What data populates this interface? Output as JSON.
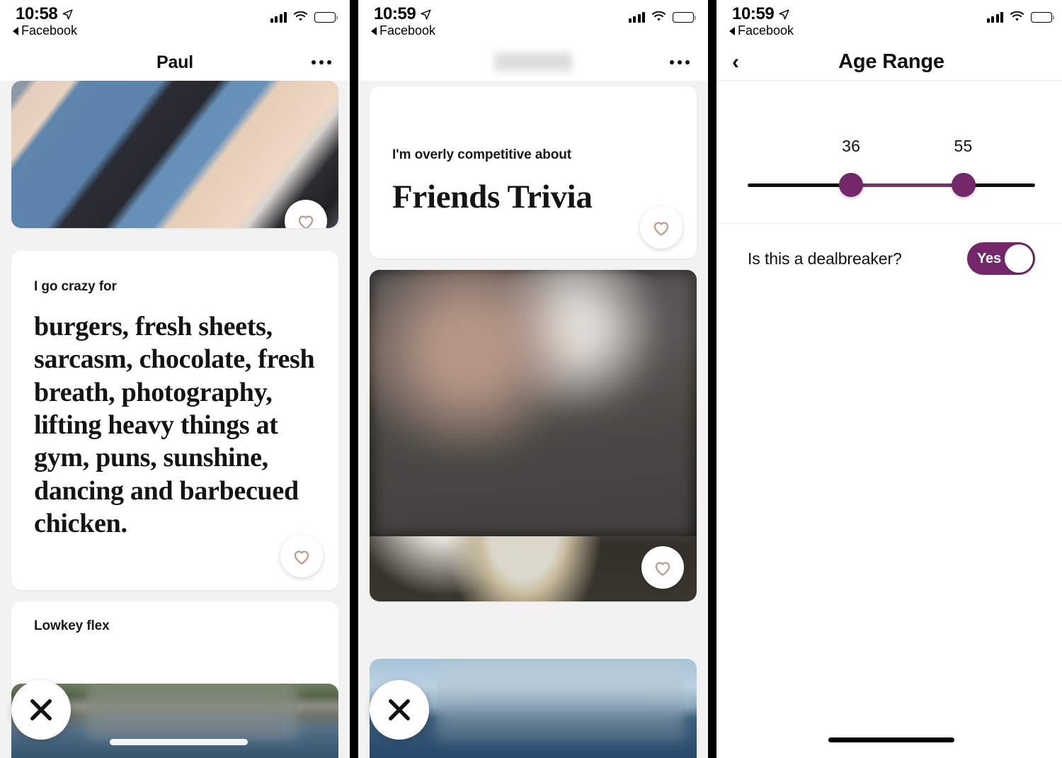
{
  "panels": [
    {
      "id": "profile-paul",
      "status_bar": {
        "time": "10:58",
        "back_app": "Facebook",
        "location_icon": "location-arrow-icon",
        "signal_icon": "cellular-signal-icon",
        "wifi_icon": "wifi-icon",
        "battery_icon": "battery-icon"
      },
      "nav": {
        "title": "Paul",
        "more_icon": "more-options-icon"
      },
      "cards": [
        {
          "type": "photo",
          "alt": "person-in-blue-tank-top-in-car",
          "like_icon": "heart-outline-icon"
        },
        {
          "type": "prompt",
          "label": "I go crazy for",
          "answer": "burgers, fresh sheets, sarcasm, chocolate, fresh breath, photography, lifting heavy things at gym, puns, sunshine, dancing and barbecued chicken.",
          "like_icon": "heart-outline-icon"
        },
        {
          "type": "prompt-partial",
          "label": "Lowkey flex"
        }
      ],
      "pass_button": {
        "icon": "close-x-icon"
      }
    },
    {
      "id": "profile-blurred",
      "status_bar": {
        "time": "10:59",
        "back_app": "Facebook",
        "location_icon": "location-arrow-icon",
        "signal_icon": "cellular-signal-icon",
        "wifi_icon": "wifi-icon",
        "battery_icon": "battery-icon"
      },
      "nav": {
        "title": "",
        "title_redacted": true,
        "more_icon": "more-options-icon"
      },
      "cards": [
        {
          "type": "prompt",
          "label": "I'm overly competitive about",
          "answer": "Friends Trivia",
          "like_icon": "heart-outline-icon"
        },
        {
          "type": "photo",
          "alt": "blurred-restaurant-dinner-photo",
          "like_icon": "heart-outline-icon"
        },
        {
          "type": "photo",
          "alt": "blurred-seaside-photo"
        }
      ],
      "pass_button": {
        "icon": "close-x-icon"
      }
    },
    {
      "id": "age-range-settings",
      "status_bar": {
        "time": "10:59",
        "back_app": "Facebook",
        "location_icon": "location-arrow-icon",
        "signal_icon": "cellular-signal-icon",
        "wifi_icon": "wifi-icon",
        "battery_icon": "battery-icon"
      },
      "nav": {
        "title": "Age Range",
        "back_icon": "chevron-left-icon"
      },
      "slider": {
        "min_value": "36",
        "max_value": "55",
        "min_percent": 36,
        "max_percent": 75,
        "track_color": "#0d0d0d",
        "active_color": "#7d2f6f",
        "knob_color": "#74286a"
      },
      "dealbreaker": {
        "label": "Is this a dealbreaker?",
        "toggle_value": "Yes",
        "toggle_on": true,
        "toggle_color": "#73276a"
      }
    }
  ],
  "colors": {
    "heart_outline": "#c0a08c",
    "accent_purple": "#74286a",
    "feed_background": "#f2f2f2",
    "card_background": "#ffffff"
  }
}
